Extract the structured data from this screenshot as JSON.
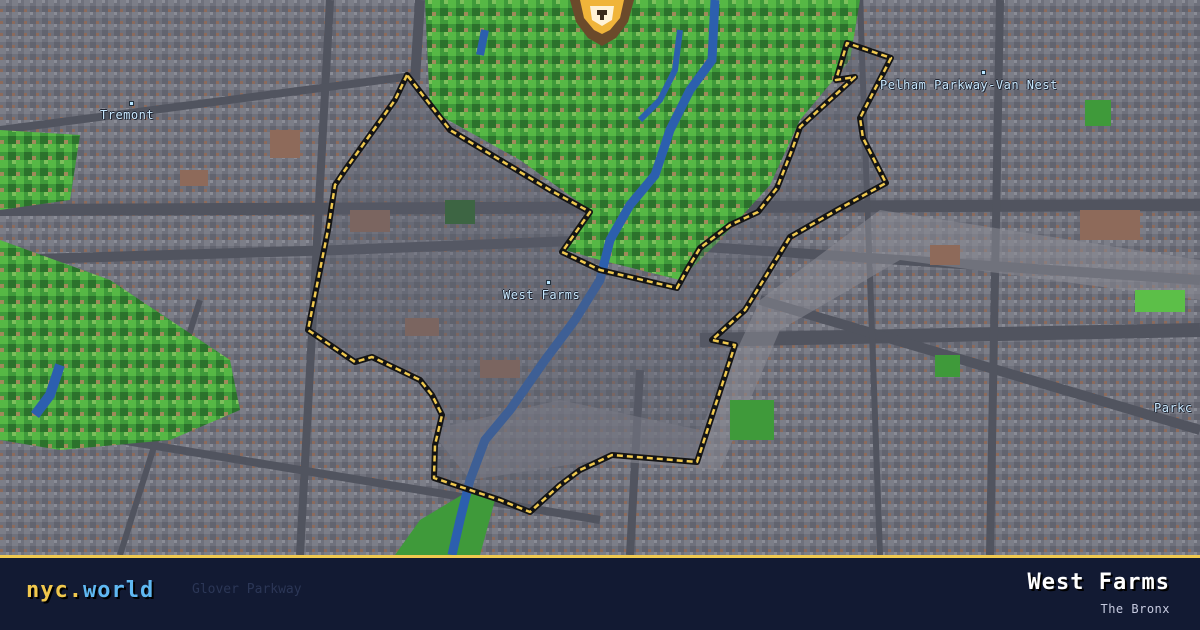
{
  "map": {
    "labels": {
      "tremont": "Tremont",
      "west_farms": "West Farms",
      "pelham": "Pelham Parkway-Van Nest",
      "parkchester": "Parkc"
    },
    "colors": {
      "land": "#6d6e78",
      "street": "#4e515c",
      "park": "#3f9a3a",
      "park_light": "#5cbf48",
      "park_dark": "#2a6a2a",
      "water": "#2c5fae",
      "brick": "#8e6a5a",
      "boundary": "#f0c94f",
      "boundary_outline": "#141414",
      "label": "#c9e9ff"
    },
    "marker_icon": "lion-icon"
  },
  "footer": {
    "brand_main": "nyc.",
    "brand_accent": "world",
    "ghost_text": "Glover Parkway",
    "neighborhood": "West Farms",
    "borough": "The Bronx",
    "background": "#121a33",
    "accent_line": "#f0c94f"
  }
}
